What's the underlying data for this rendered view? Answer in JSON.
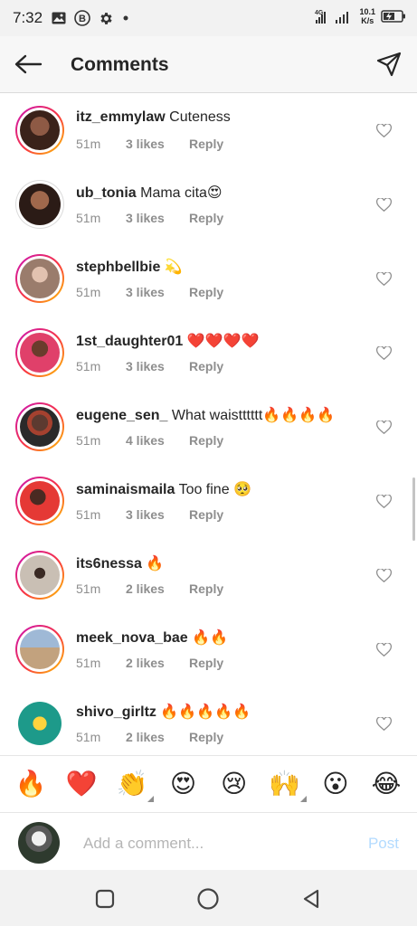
{
  "status_bar": {
    "time": "7:32",
    "net_speed_value": "10.1",
    "net_speed_unit": "K/s",
    "network_type": "4G"
  },
  "header": {
    "title": "Comments"
  },
  "comments": [
    {
      "username": "itz_emmylaw",
      "text": "Cuteness",
      "time": "51m",
      "likes": "3 likes",
      "reply": "Reply",
      "story_ring": true,
      "avatar_color": "#6b3b2a"
    },
    {
      "username": "ub_tonia",
      "text": "Mama cita😍",
      "time": "51m",
      "likes": "3 likes",
      "reply": "Reply",
      "story_ring": false,
      "avatar_color": "#7b4a35"
    },
    {
      "username": "stephbellbie",
      "text": "💫",
      "time": "51m",
      "likes": "3 likes",
      "reply": "Reply",
      "story_ring": true,
      "avatar_color": "#b98a74"
    },
    {
      "username": "1st_daughter01",
      "text": "❤️❤️❤️❤️",
      "time": "51m",
      "likes": "3 likes",
      "reply": "Reply",
      "story_ring": true,
      "avatar_color": "#d44a6e"
    },
    {
      "username": "eugene_sen_",
      "text": "What waistttttt🔥🔥🔥🔥",
      "time": "51m",
      "likes": "4 likes",
      "reply": "Reply",
      "story_ring": true,
      "avatar_color": "#4a3a36"
    },
    {
      "username": "saminaismaila",
      "text": "Too fine 🥺",
      "time": "51m",
      "likes": "3 likes",
      "reply": "Reply",
      "story_ring": true,
      "avatar_color": "#d8333a"
    },
    {
      "username": "its6nessa",
      "text": "🔥",
      "time": "51m",
      "likes": "2 likes",
      "reply": "Reply",
      "story_ring": true,
      "avatar_color": "#8a7b70"
    },
    {
      "username": "meek_nova_bae",
      "text": "🔥🔥",
      "time": "51m",
      "likes": "2 likes",
      "reply": "Reply",
      "story_ring": true,
      "avatar_color": "#a88b6e"
    },
    {
      "username": "shivo_girltz",
      "text": "🔥🔥🔥🔥🔥",
      "time": "51m",
      "likes": "2 likes",
      "reply": "Reply",
      "story_ring": false,
      "avatar_color": "#1d9a8a"
    }
  ],
  "reactions": [
    "🔥",
    "❤️",
    "👏",
    "😍",
    "😢",
    "🙌",
    "😮",
    "😂"
  ],
  "add_comment": {
    "placeholder": "Add a comment...",
    "post_label": "Post"
  }
}
